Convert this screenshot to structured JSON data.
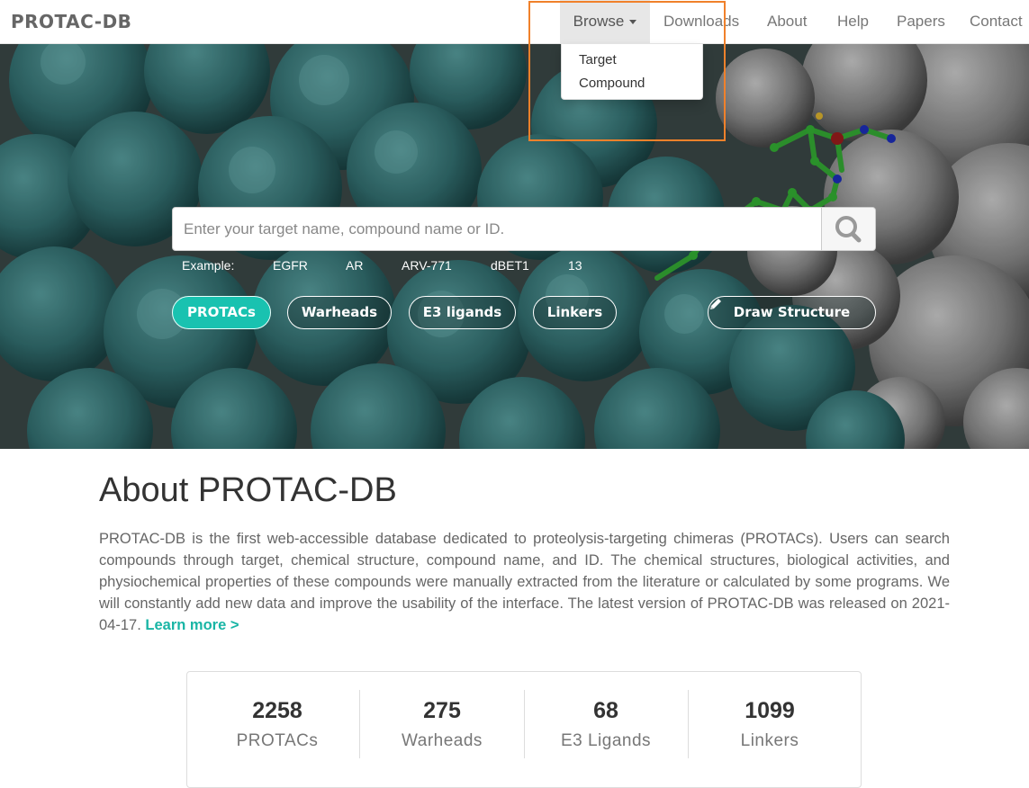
{
  "brand": "PROTAC-DB",
  "nav": {
    "browse": "Browse",
    "downloads": "Downloads",
    "about": "About",
    "help": "Help",
    "papers": "Papers",
    "contact": "Contact"
  },
  "browse_menu": {
    "target": "Target",
    "compound": "Compound"
  },
  "search": {
    "placeholder": "Enter your target name, compound name or ID.",
    "example_label": "Example:",
    "examples": [
      "EGFR",
      "AR",
      "ARV-771",
      "dBET1",
      "13"
    ]
  },
  "categories": {
    "protacs": "PROTACs",
    "warheads": "Warheads",
    "e3_ligands": "E3 ligands",
    "linkers": "Linkers",
    "draw_structure": "Draw Structure"
  },
  "about": {
    "title": "About PROTAC-DB",
    "text": "PROTAC-DB is the first web-accessible database dedicated to proteolysis-targeting chimeras (PROTACs). Users can search compounds through target, chemical structure, compound name, and ID. The chemical structures, biological activities, and physiochemical properties of these compounds were manually extracted from the literature or calculated by some programs. We will constantly add new data and improve the usability of the interface. The latest version of PROTAC-DB was released on 2021-04-17.",
    "learn_more": "Learn more >"
  },
  "stats": [
    {
      "value": "2258",
      "label": "PROTACs"
    },
    {
      "value": "275",
      "label": "Warheads"
    },
    {
      "value": "68",
      "label": "E3 Ligands"
    },
    {
      "value": "1099",
      "label": "Linkers"
    }
  ],
  "colors": {
    "accent": "#19c2b0",
    "highlight": "#f0812b",
    "protein": "#2e6566",
    "protein_grey": "#8a8a8a"
  }
}
